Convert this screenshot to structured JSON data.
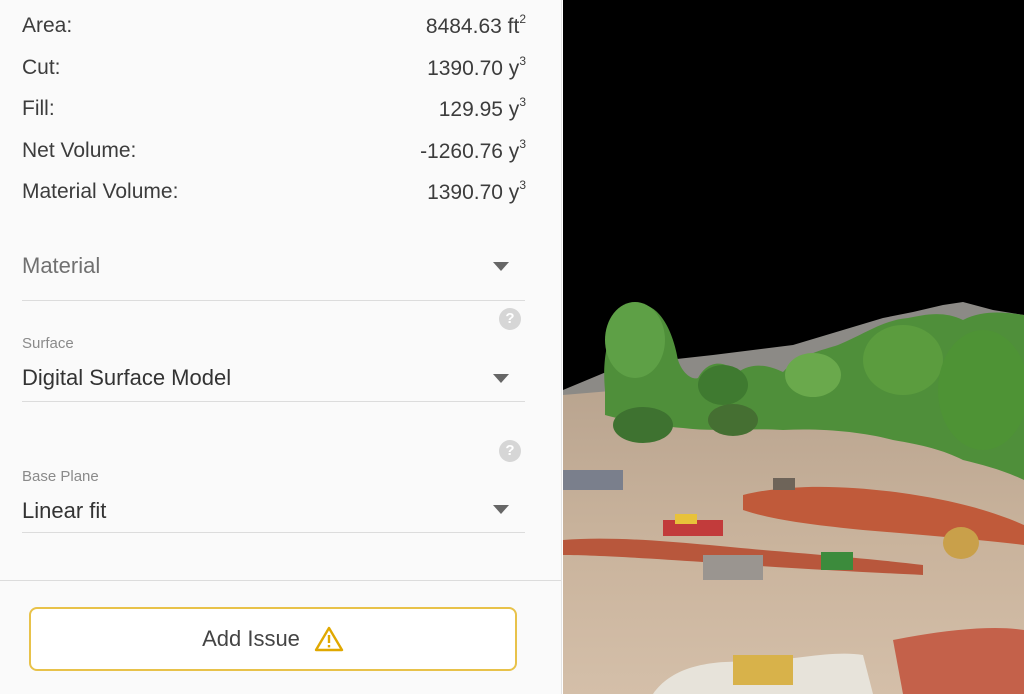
{
  "stats": [
    {
      "label": "Area:",
      "value": "8484.63 ft",
      "sup": "2"
    },
    {
      "label": "Cut:",
      "value": "1390.70 y",
      "sup": "3"
    },
    {
      "label": "Fill:",
      "value": "129.95 y",
      "sup": "3"
    },
    {
      "label": "Net Volume:",
      "value": "-1260.76 y",
      "sup": "3"
    },
    {
      "label": "Material Volume:",
      "value": "1390.70 y",
      "sup": "3"
    }
  ],
  "material": {
    "placeholder": "Material"
  },
  "surface": {
    "label": "Surface",
    "value": "Digital Surface Model"
  },
  "base_plane": {
    "label": "Base Plane",
    "value": "Linear fit"
  },
  "help_glyph": "?",
  "add_issue": {
    "label": "Add Issue"
  },
  "icons": {
    "dropdown": "caret-down-icon",
    "help": "help-circle-icon",
    "warning": "warning-triangle-icon"
  },
  "colors": {
    "accent": "#e8c24a",
    "warning_icon": "#e0a800"
  }
}
